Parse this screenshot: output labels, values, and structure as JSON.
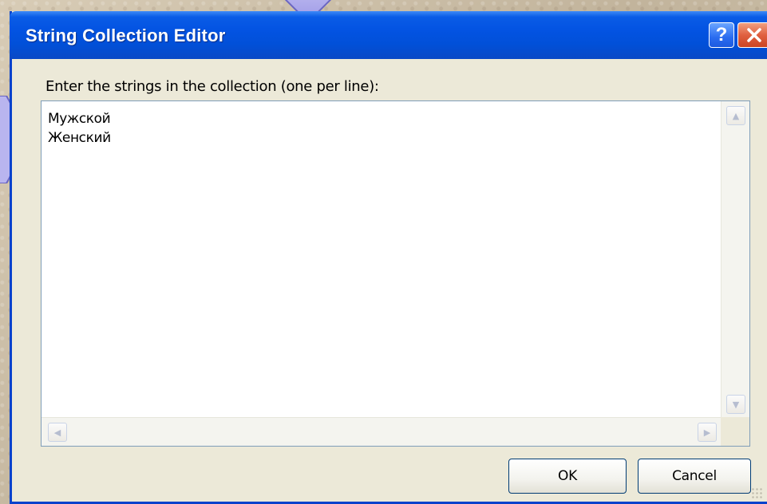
{
  "window": {
    "title": "String Collection Editor",
    "help_glyph": "?",
    "close_glyph": "✕"
  },
  "prompt": {
    "label": "Enter the strings in the collection (one per line):"
  },
  "editor": {
    "lines": [
      "Мужской",
      "Женский"
    ]
  },
  "scrollbars": {
    "up_glyph": "▲",
    "down_glyph": "▼",
    "left_glyph": "◀",
    "right_glyph": "▶"
  },
  "buttons": {
    "ok_label": "OK",
    "cancel_label": "Cancel"
  },
  "colors": {
    "titlebar": "#0353e2",
    "dialog_face": "#ece9d8",
    "close_button": "#e06040"
  },
  "icons": [
    "help-icon",
    "close-icon",
    "scroll-up-arrow-icon",
    "scroll-down-arrow-icon",
    "scroll-left-arrow-icon",
    "scroll-right-arrow-icon",
    "resize-grip-icon"
  ]
}
